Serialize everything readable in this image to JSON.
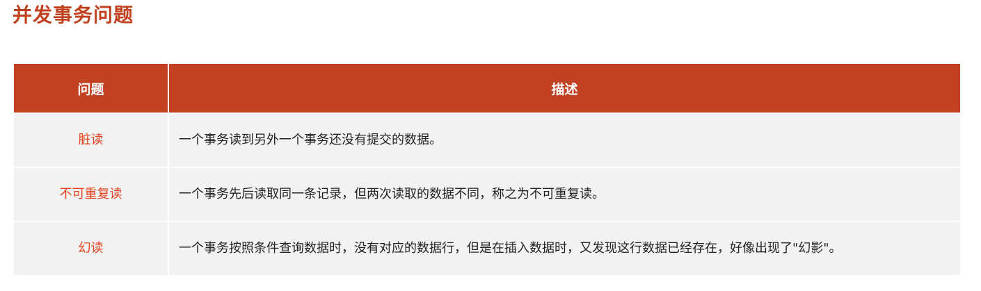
{
  "page": {
    "title": "并发事务问题"
  },
  "table": {
    "headers": {
      "problem": "问题",
      "description": "描述"
    },
    "rows": [
      {
        "problem": "脏读",
        "description": "一个事务读到另外一个事务还没有提交的数据。"
      },
      {
        "problem": "不可重复读",
        "description": "一个事务先后读取同一条记录，但两次读取的数据不同，称之为不可重复读。"
      },
      {
        "problem": "幻读",
        "description": "一个事务按照条件查询数据时，没有对应的数据行，但是在插入数据时，又发现这行数据已经存在，好像出现了\"幻影\"。"
      }
    ]
  },
  "colors": {
    "title": "#c1401f",
    "header_bg": "#c24123",
    "problem_text": "#e5411f",
    "row_bg": "#f2f2f2"
  }
}
